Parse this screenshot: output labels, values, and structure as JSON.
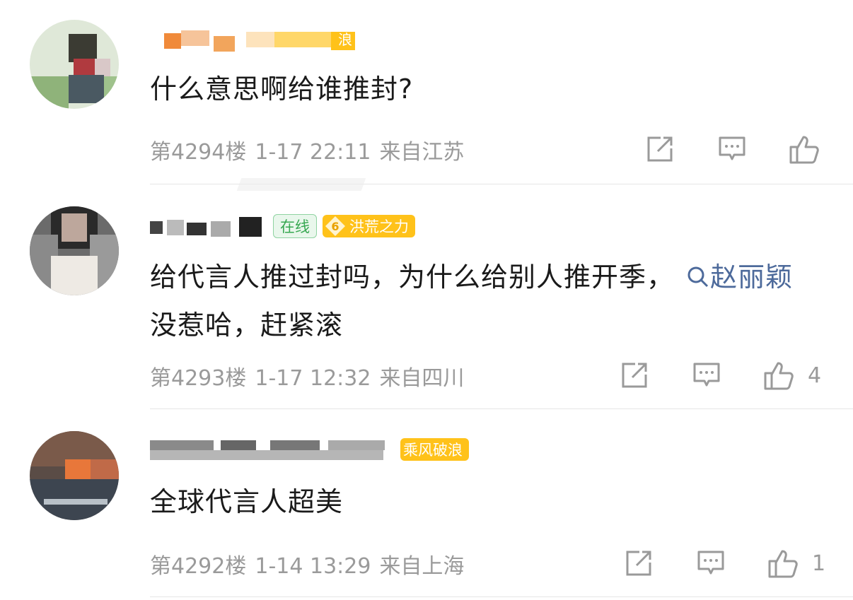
{
  "comments": [
    {
      "text": "什么意思啊给谁推封?",
      "floor": "第4294楼",
      "date": "1-17 22:11",
      "location": "来自江苏",
      "likes": "",
      "badge_partial": "浪"
    },
    {
      "text": "给代言人推过封吗，为什么给别人推开季，",
      "link_text": "赵丽颖",
      "text_after": "没惹哈，赶紧滚",
      "floor": "第4293楼",
      "date": "1-17 12:32",
      "location": "来自四川",
      "likes": "4",
      "online_badge": "在线",
      "level_badge": "洪荒之力",
      "level_number": "6"
    },
    {
      "text": "全球代言人超美",
      "floor": "第4292楼",
      "date": "1-14 13:29",
      "location": "来自上海",
      "likes": "1",
      "level_badge": "乘风破浪"
    }
  ],
  "icons": [
    "share-icon",
    "reply-icon",
    "like-icon",
    "search-icon"
  ],
  "colors": {
    "link": "#4d6a9b",
    "meta": "#9a9a9a",
    "badge_yellow": "#ffc21a",
    "online_green": "#38a852"
  }
}
